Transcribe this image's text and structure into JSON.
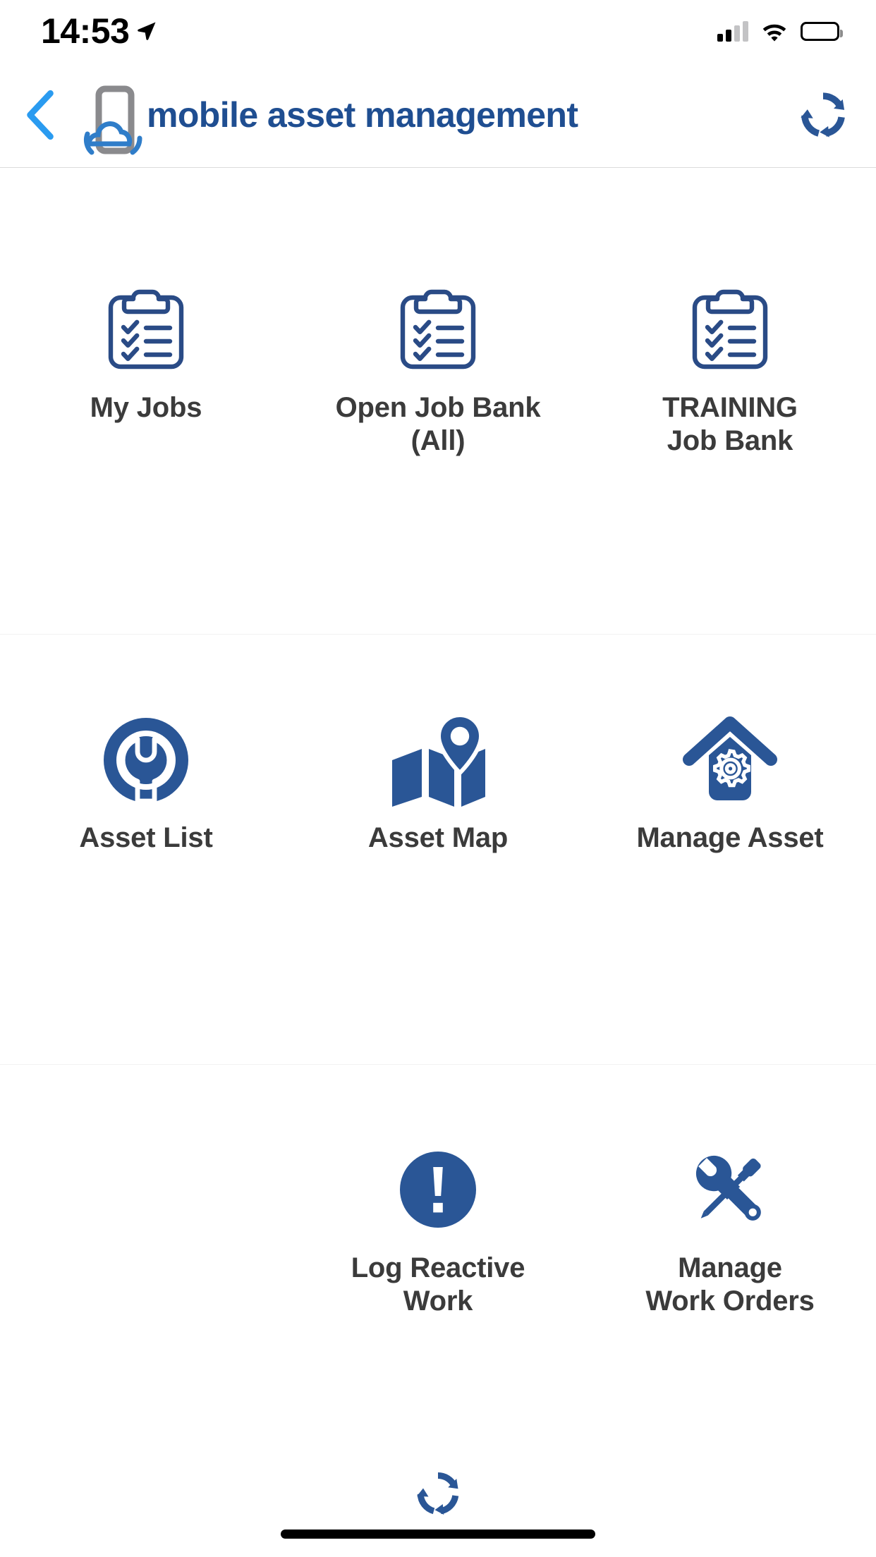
{
  "status_bar": {
    "time": "14:53",
    "location_icon": "location-arrow-icon",
    "signal_icon": "cellular-signal-icon",
    "wifi_icon": "wifi-icon",
    "battery_icon": "battery-full-icon"
  },
  "nav_bar": {
    "back_icon": "back-chevron-icon",
    "logo_icon": "mobile-cloud-logo-icon",
    "title": "mobile asset management",
    "sync_icon": "sync-refresh-icon"
  },
  "menu": {
    "rows": [
      {
        "tiles": [
          {
            "label": "My Jobs",
            "icon": "clipboard-checklist-icon"
          },
          {
            "label": "Open Job Bank\n(All)",
            "icon": "clipboard-checklist-icon"
          },
          {
            "label": "TRAINING\nJob Bank",
            "icon": "clipboard-checklist-icon"
          }
        ]
      },
      {
        "tiles": [
          {
            "label": "Asset List",
            "icon": "gear-wrench-icon"
          },
          {
            "label": "Asset Map",
            "icon": "map-pin-icon"
          },
          {
            "label": "Manage Asset",
            "icon": "house-gear-icon"
          }
        ]
      },
      {
        "tiles": [
          {
            "label": "",
            "icon": ""
          },
          {
            "label": "Log Reactive\nWork",
            "icon": "exclamation-circle-icon"
          },
          {
            "label": "Manage\nWork Orders",
            "icon": "wrench-screwdriver-icon"
          }
        ]
      }
    ]
  },
  "bottom_bar": {
    "sync_icon": "sync-refresh-icon",
    "home_indicator": "home-indicator"
  },
  "colors": {
    "brand_blue": "#1f4e91",
    "icon_blue": "#2a5696",
    "label_grey": "#3b3b3b",
    "back_blue": "#2a9bf0",
    "logo_grey": "#8a8a8d",
    "background": "#ffffff"
  }
}
